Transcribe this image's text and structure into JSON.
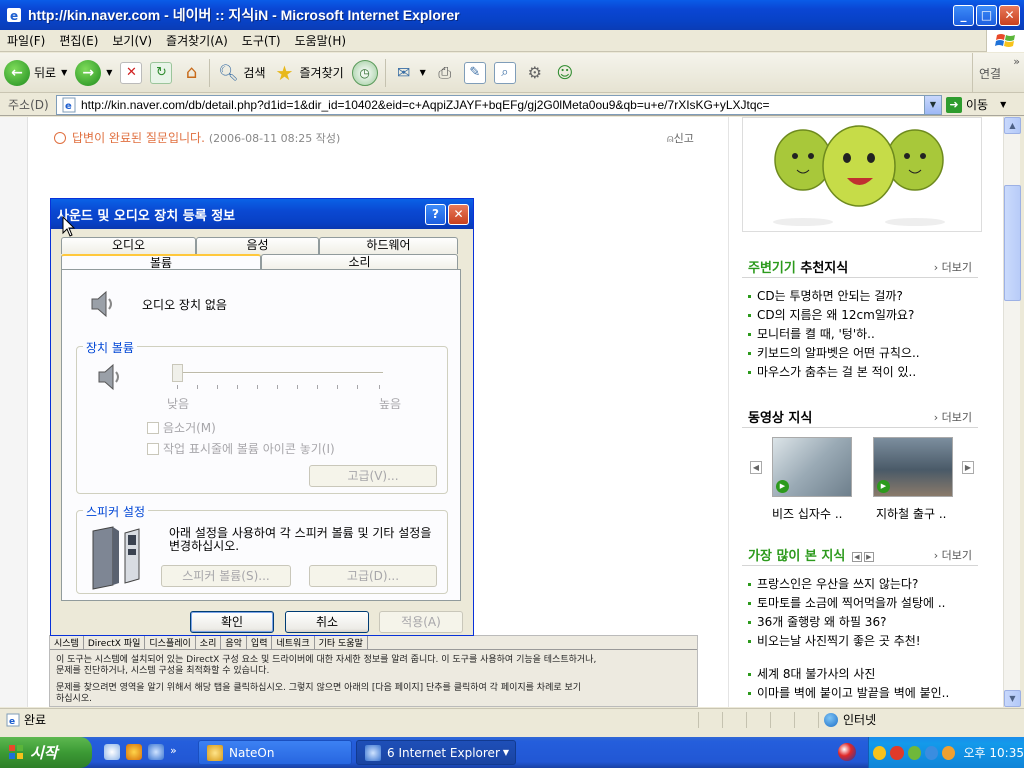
{
  "window": {
    "title": "http://kin.naver.com - 네이버 :: 지식iN - Microsoft Internet Explorer",
    "minimize": "_",
    "maximize": "□",
    "close": "✕"
  },
  "menu": [
    "파일(F)",
    "편집(E)",
    "보기(V)",
    "즐겨찾기(A)",
    "도구(T)",
    "도움말(H)"
  ],
  "toolbar": {
    "back": "뒤로",
    "search": "검색",
    "favorites": "즐겨찾기",
    "connect": "연결",
    "more": "»"
  },
  "address": {
    "label": "주소(D)",
    "url": "http://kin.naver.com/db/detail.php?d1id=1&dir_id=10402&eid=c+AqpiZJAYF+bqEFg/gj2G0lMeta0ou9&qb=u+e/7rXIsKG+yLXJtqc=",
    "go": "이동"
  },
  "page": {
    "status": "답변이 완료된 질문입니다.",
    "date": "(2006-08-11 08:25 작성)",
    "report": "신고",
    "bg_tabs": [
      "시스템",
      "DirectX 파일",
      "디스플레이",
      "소리",
      "음악",
      "입력",
      "네트워크",
      "기타 도움말"
    ],
    "bg_text_1": "이 도구는 시스템에 설치되어 있는 DirectX 구성 요소 및 드라이버에 대한 자세한 정보를 알려 줍니다. 이 도구를 사용하여 기능을 테스트하거나,",
    "bg_text_2": "문제를 진단하거나, 시스템 구성을 최적화할 수 있습니다.",
    "bg_text_3": "문제를 찾으려면 영역을 알기 위해서 해당 탭을 클릭하십시오. 그렇지 않으면 아래의 [다음 페이지] 단추를 클릭하여 각 페이지를 차례로 보기",
    "bg_text_4": "하십시오."
  },
  "sidebar": {
    "sec1_title_green": "주변기기",
    "sec1_title_rest": " 추천지식",
    "more": "더보기",
    "sec1_items": [
      "CD는 투명하면 안되는 걸까?",
      "CD의 지름은 왜 12cm일까요?",
      "모니터를 켤 때, '텅'하..",
      "키보드의 알파벳은 어떤 규칙으..",
      "마우스가 춤추는 걸 본 적이 있.."
    ],
    "sec2_title": "동영상 지식",
    "videos": [
      "비즈 십자수 ..",
      "지하철 출구 .."
    ],
    "sec3_title": "가장 많이 본 지식",
    "sec3_items": [
      "프랑스인은 우산을 쓰지 않는다?",
      "토마토를 소금에 찍어먹을까 설탕에 ..",
      "36개 줄행랑 왜 하필 36?",
      "비오는날 사진찍기 좋은 곳 추천!",
      "세계 8대 불가사의 사진",
      "이마를 벽에 붙이고 발끝을 벽에 붙인.."
    ]
  },
  "statusbar": {
    "text": "완료",
    "zone": "인터넷"
  },
  "taskbar": {
    "start": "시작",
    "tasks": [
      "NateOn",
      "6 Internet Explorer"
    ],
    "time": "오후 10:35"
  },
  "dialog": {
    "title": "사운드 및 오디오 장치 등록 정보",
    "help": "?",
    "close": "✕",
    "tabs_top": [
      "오디오",
      "음성",
      "하드웨어"
    ],
    "tabs_bottom": [
      "볼륨",
      "소리"
    ],
    "no_device": "오디오 장치 없음",
    "volume_group": "장치 볼륨",
    "low": "낮음",
    "high": "높음",
    "mute": "음소거(M)",
    "tray_icon": "작업 표시줄에 볼륨 아이콘 놓기(I)",
    "advanced": "고급(V)...",
    "speaker_group": "스피커 설정",
    "speaker_desc": "아래 설정을 사용하여 각 스피커 볼륨 및 기타 설정을 변경하십시오.",
    "speaker_volume": "스피커 볼륨(S)...",
    "advanced2": "고급(D)...",
    "ok": "확인",
    "cancel": "취소",
    "apply": "적용(A)",
    "volume_level": 0
  }
}
